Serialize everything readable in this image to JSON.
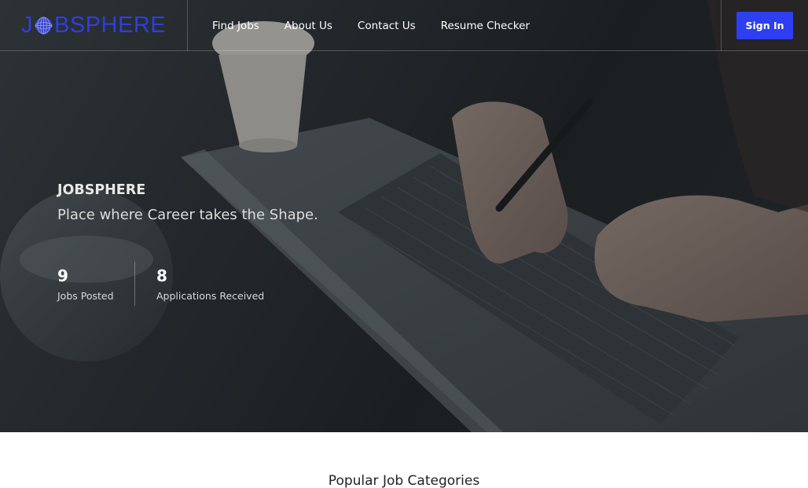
{
  "nav": {
    "brand": {
      "prefix": "J",
      "suffix": "BSPHERE"
    },
    "links": [
      "Find Jobs",
      "About Us",
      "Contact Us",
      "Resume Checker"
    ],
    "sign_in": "Sign In"
  },
  "hero": {
    "title": "JOBSPHERE",
    "subtitle": "Place where Career takes the Shape.",
    "stats": [
      {
        "value": "9",
        "label": "Jobs Posted"
      },
      {
        "value": "8",
        "label": "Applications Received"
      }
    ]
  },
  "sections": {
    "popular_title": "Popular Job Categories"
  },
  "colors": {
    "accent": "#2d3ff0",
    "brand": "#2f3fe0"
  }
}
